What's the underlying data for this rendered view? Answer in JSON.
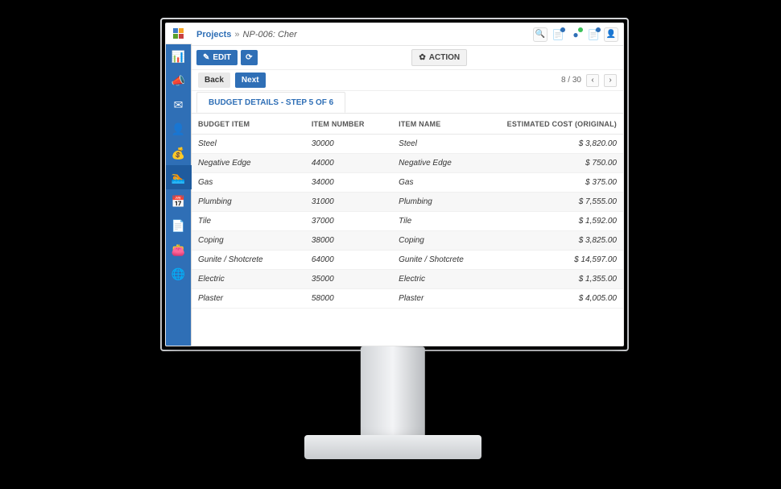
{
  "sidebar": {
    "items": [
      {
        "name": "dashboard",
        "aria": "chart-icon"
      },
      {
        "name": "campaigns",
        "aria": "megaphone-icon"
      },
      {
        "name": "mail",
        "aria": "mail-icon"
      },
      {
        "name": "contacts",
        "aria": "person-icon"
      },
      {
        "name": "billing",
        "aria": "money-bag-icon"
      },
      {
        "name": "pools",
        "aria": "pool-icon",
        "active": true
      },
      {
        "name": "calendar",
        "aria": "calendar-icon"
      },
      {
        "name": "documents",
        "aria": "document-icon"
      },
      {
        "name": "expenses",
        "aria": "wallet-icon"
      },
      {
        "name": "globe",
        "aria": "globe-icon"
      }
    ]
  },
  "breadcrumb": {
    "root": "Projects",
    "current": "NP-006: Cher"
  },
  "toolbar": {
    "edit_label": "EDIT",
    "refresh_aria": "refresh",
    "action_label": "ACTION"
  },
  "pager": {
    "back_label": "Back",
    "next_label": "Next",
    "page_info": "8 / 30"
  },
  "tab": {
    "label": "BUDGET DETAILS - STEP 5 OF 6"
  },
  "table": {
    "headers": {
      "budget_item": "BUDGET ITEM",
      "item_number": "ITEM NUMBER",
      "item_name": "ITEM NAME",
      "estimated_cost": "ESTIMATED COST (ORIGINAL)"
    },
    "rows": [
      {
        "budget_item": "Steel",
        "item_number": "30000",
        "item_name": "Steel",
        "estimated_cost": "$ 3,820.00"
      },
      {
        "budget_item": "Negative Edge",
        "item_number": "44000",
        "item_name": "Negative Edge",
        "estimated_cost": "$ 750.00"
      },
      {
        "budget_item": "Gas",
        "item_number": "34000",
        "item_name": "Gas",
        "estimated_cost": "$ 375.00"
      },
      {
        "budget_item": "Plumbing",
        "item_number": "31000",
        "item_name": "Plumbing",
        "estimated_cost": "$ 7,555.00"
      },
      {
        "budget_item": "Tile",
        "item_number": "37000",
        "item_name": "Tile",
        "estimated_cost": "$ 1,592.00"
      },
      {
        "budget_item": "Coping",
        "item_number": "38000",
        "item_name": "Coping",
        "estimated_cost": "$ 3,825.00"
      },
      {
        "budget_item": "Gunite / Shotcrete",
        "item_number": "64000",
        "item_name": "Gunite / Shotcrete",
        "estimated_cost": "$ 14,597.00"
      },
      {
        "budget_item": "Electric",
        "item_number": "35000",
        "item_name": "Electric",
        "estimated_cost": "$ 1,355.00"
      },
      {
        "budget_item": "Plaster",
        "item_number": "58000",
        "item_name": "Plaster",
        "estimated_cost": "$ 4,005.00"
      }
    ]
  },
  "topbar_icons": {
    "search_aria": "search",
    "notes_aria": "notes",
    "alerts_aria": "alerts",
    "messages_aria": "messages",
    "user_aria": "user"
  }
}
